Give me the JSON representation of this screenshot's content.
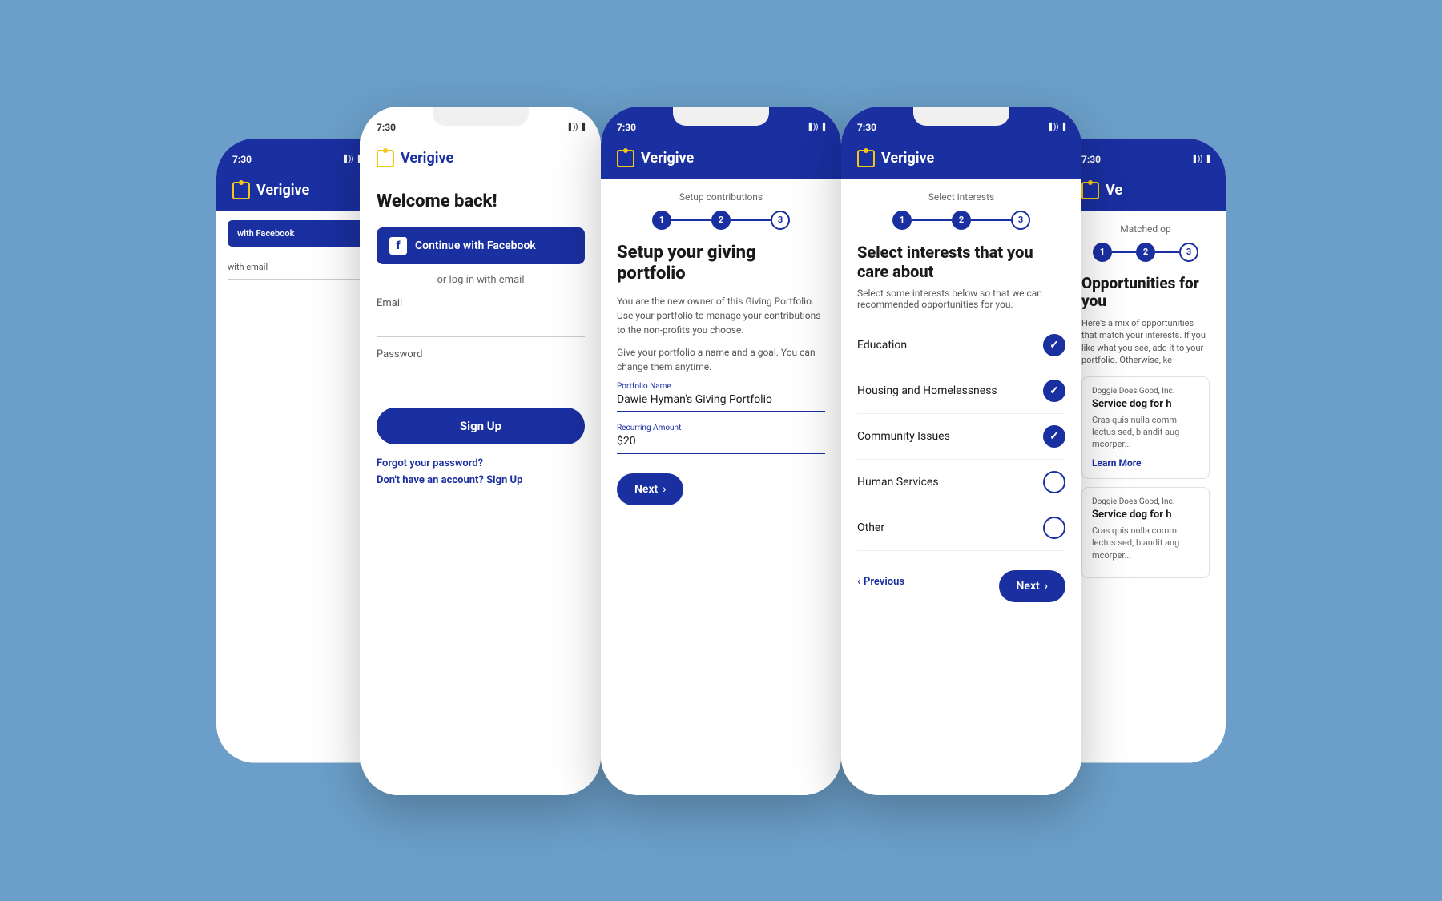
{
  "app": {
    "name": "Verigive",
    "status_time": "7:30"
  },
  "phone1": {
    "app_name": "Verigive",
    "fb_button": "with Facebook",
    "email_label": "with email"
  },
  "phone2": {
    "status_time": "7:30",
    "welcome_title": "Welcome back!",
    "fb_button_label": "Continue with Facebook",
    "or_text": "or log in with email",
    "email_label": "Email",
    "password_label": "Password",
    "sign_up_label": "Sign Up",
    "forgot_pw": "Forgot your password?",
    "no_account": "Don't have an account?",
    "sign_up_link": "Sign Up"
  },
  "phone3": {
    "status_time": "7:30",
    "progress_label": "Setup contributions",
    "step1": "1",
    "step2": "2",
    "step3": "3",
    "title": "Setup your giving portfolio",
    "desc1": "You are the new owner of this Giving Portfolio. Use your portfolio to manage your contributions to the non-profits you choose.",
    "desc2": "Give your portfolio a name and a goal. You can change them anytime.",
    "portfolio_label": "Portfolio Name",
    "portfolio_value": "Dawie Hyman's Giving Portfolio",
    "amount_label": "Recurring Amount",
    "amount_value": "$20",
    "next_label": "Next"
  },
  "phone4": {
    "status_time": "7:30",
    "progress_label": "Select interests",
    "step1": "1",
    "step2": "2",
    "step3": "3",
    "title": "Select interests that you care about",
    "desc": "Select some interests below so that we can recommended opportunities for you.",
    "interests": [
      {
        "name": "Education",
        "checked": true
      },
      {
        "name": "Housing and Homelessness",
        "checked": true
      },
      {
        "name": "Community Issues",
        "checked": true
      },
      {
        "name": "Human Services",
        "checked": false
      },
      {
        "name": "Other",
        "checked": false
      }
    ],
    "prev_label": "Previous",
    "next_label": "Next"
  },
  "phone5": {
    "status_time": "7:30",
    "progress_label": "Matched op",
    "step1": "1",
    "step2": "2",
    "step3": "3",
    "title": "Opportunities for you",
    "desc": "Here's a mix of opportunities that match your interests. If you like what you see, add it to your portfolio. Otherwise, ke",
    "card1": {
      "org": "Doggie Does Good, Inc.",
      "title": "Service dog for h",
      "desc": "Cras quis nulla comm lectus sed, blandit aug mcorper..."
    },
    "card2": {
      "org": "Doggie Does Good, Inc.",
      "title": "Service dog for h",
      "desc": "Cras quis nulla comm lectus sed, blandit aug mcorper..."
    },
    "learn_more": "Learn More"
  }
}
